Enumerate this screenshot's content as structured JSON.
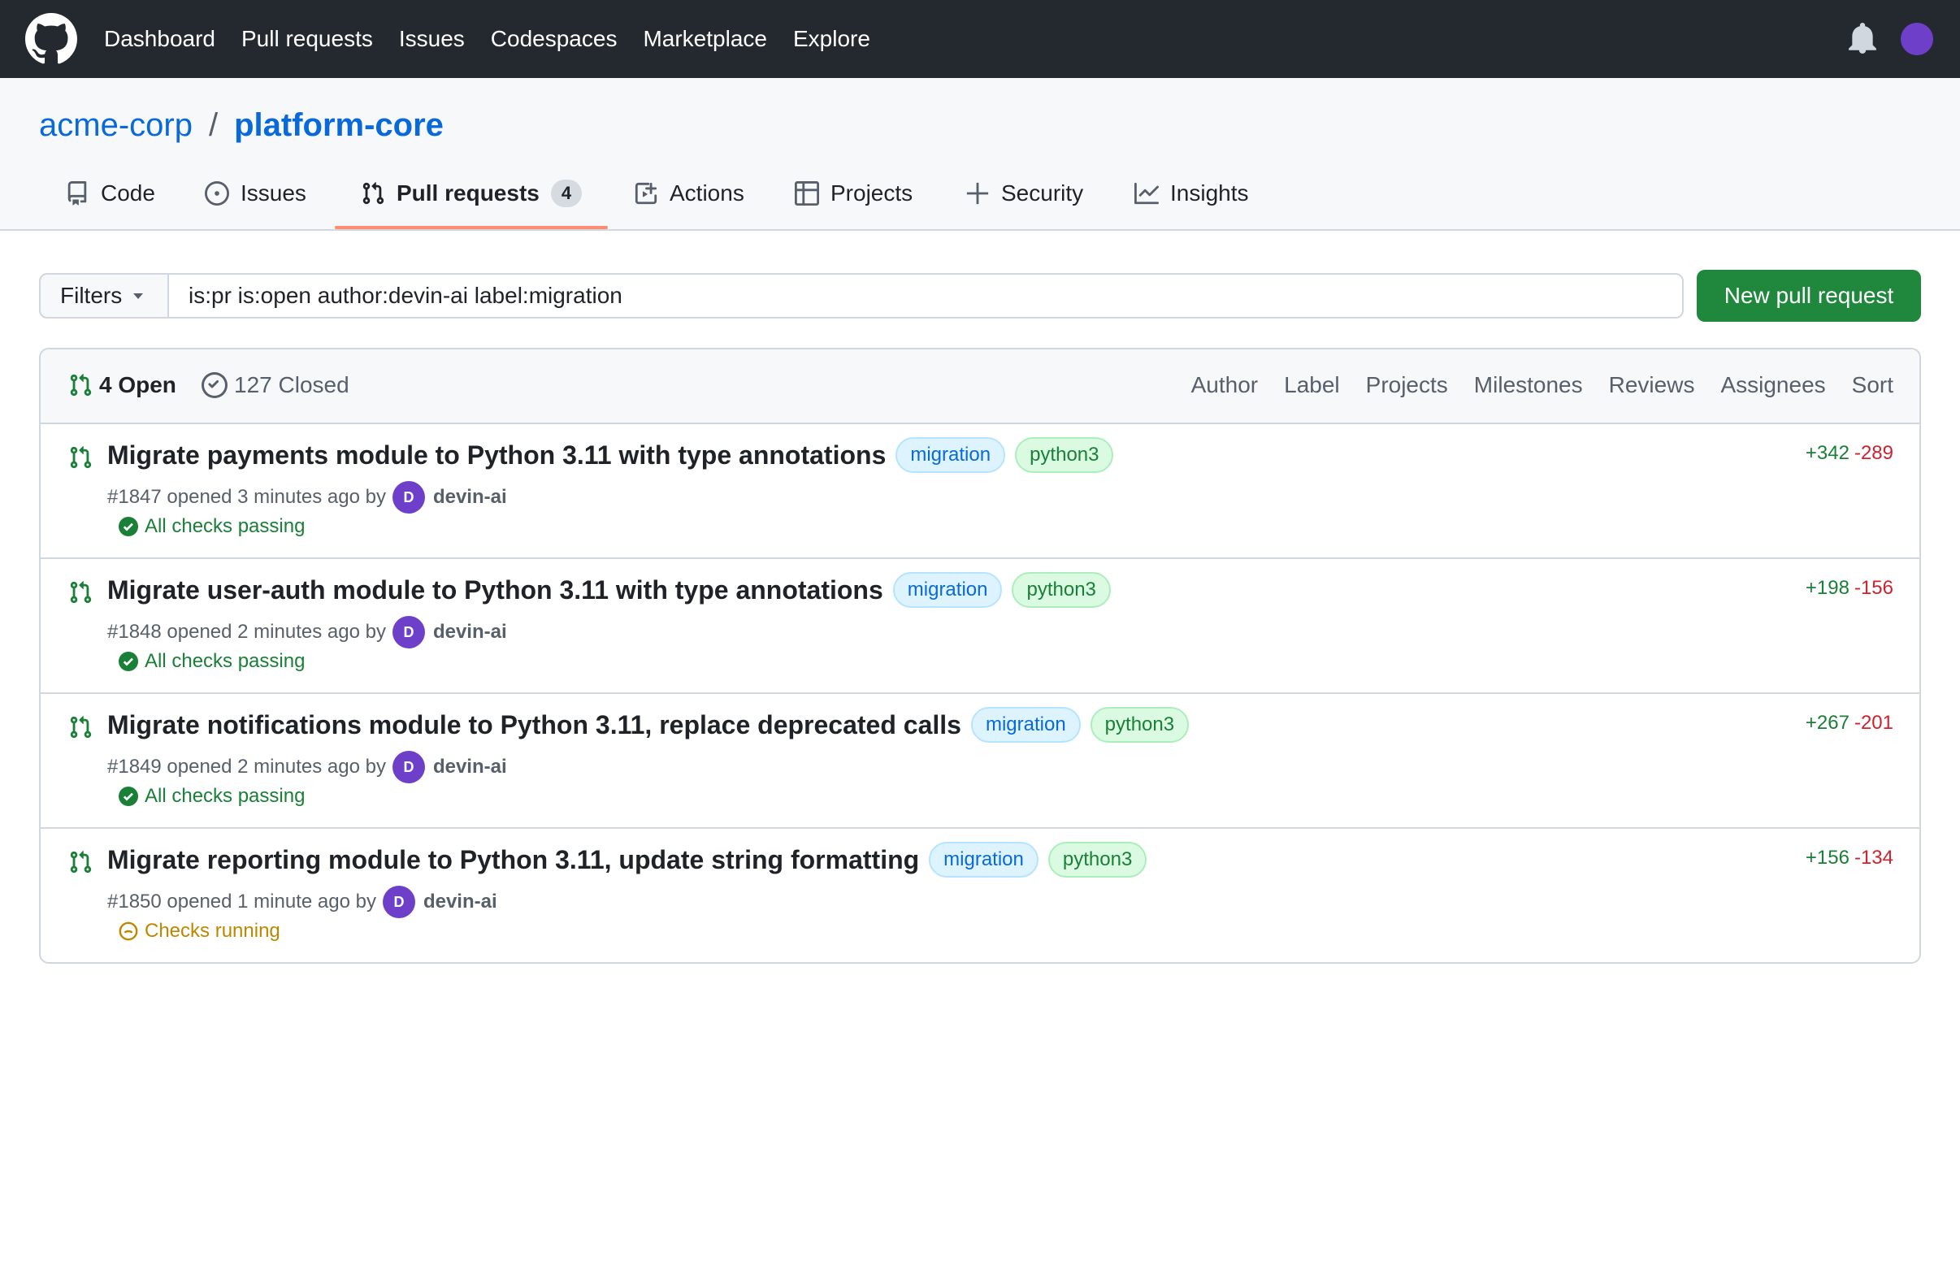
{
  "topnav": {
    "items": [
      "Dashboard",
      "Pull requests",
      "Issues",
      "Codespaces",
      "Marketplace",
      "Explore"
    ],
    "logo_icon": "github-mark-icon",
    "notifications_icon": "bell-icon",
    "avatar_color": "#6e40c9"
  },
  "repo": {
    "owner": "acme-corp",
    "separator": "/",
    "name": "platform-core"
  },
  "tabs": [
    {
      "label": "Code",
      "icon": "code-book-icon"
    },
    {
      "label": "Issues",
      "icon": "issue-opened-icon"
    },
    {
      "label": "Pull requests",
      "icon": "git-pull-request-icon",
      "count": "4",
      "active": true
    },
    {
      "label": "Actions",
      "icon": "play-icon"
    },
    {
      "label": "Projects",
      "icon": "table-icon"
    },
    {
      "label": "Security",
      "icon": "shield-icon"
    },
    {
      "label": "Insights",
      "icon": "graph-icon"
    }
  ],
  "filterbar": {
    "filters_label": "Filters",
    "query": "is:pr is:open author:devin-ai label:migration",
    "new_pr_label": "New pull request"
  },
  "list": {
    "open_label": "4 Open",
    "closed_label": "127 Closed",
    "header_filters": [
      "Author",
      "Label",
      "Projects",
      "Milestones",
      "Reviews",
      "Assignees",
      "Sort"
    ],
    "items": [
      {
        "title": "Migrate payments module to Python 3.11 with type annotations",
        "labels": [
          "migration",
          "python3"
        ],
        "meta_prefix": "#1847 opened 3 minutes ago by",
        "avatar_initial": "D",
        "author": "devin-ai",
        "status": "All checks passing",
        "status_type": "pass",
        "additions": "+342",
        "deletions": "-289"
      },
      {
        "title": "Migrate user-auth module to Python 3.11 with type annotations",
        "labels": [
          "migration",
          "python3"
        ],
        "meta_prefix": "#1848 opened 2 minutes ago by",
        "avatar_initial": "D",
        "author": "devin-ai",
        "status": "All checks passing",
        "status_type": "pass",
        "additions": "+198",
        "deletions": "-156"
      },
      {
        "title": "Migrate notifications module to Python 3.11, replace deprecated calls",
        "labels": [
          "migration",
          "python3"
        ],
        "meta_prefix": "#1849 opened 2 minutes ago by",
        "avatar_initial": "D",
        "author": "devin-ai",
        "status": "All checks passing",
        "status_type": "pass",
        "additions": "+267",
        "deletions": "-201"
      },
      {
        "title": "Migrate reporting module to Python 3.11, update string formatting",
        "labels": [
          "migration",
          "python3"
        ],
        "meta_prefix": "#1850 opened 1 minute ago by",
        "avatar_initial": "D",
        "author": "devin-ai",
        "status": "Checks running",
        "status_type": "running",
        "additions": "+156",
        "deletions": "-134"
      }
    ]
  },
  "colors": {
    "header_bg": "#24292f",
    "link_blue": "#0969da",
    "success_green": "#1a7f37",
    "button_green": "#1f883d",
    "danger_red": "#cf222e",
    "pending_yellow": "#bf8700",
    "tab_underline": "#fd8c73"
  }
}
